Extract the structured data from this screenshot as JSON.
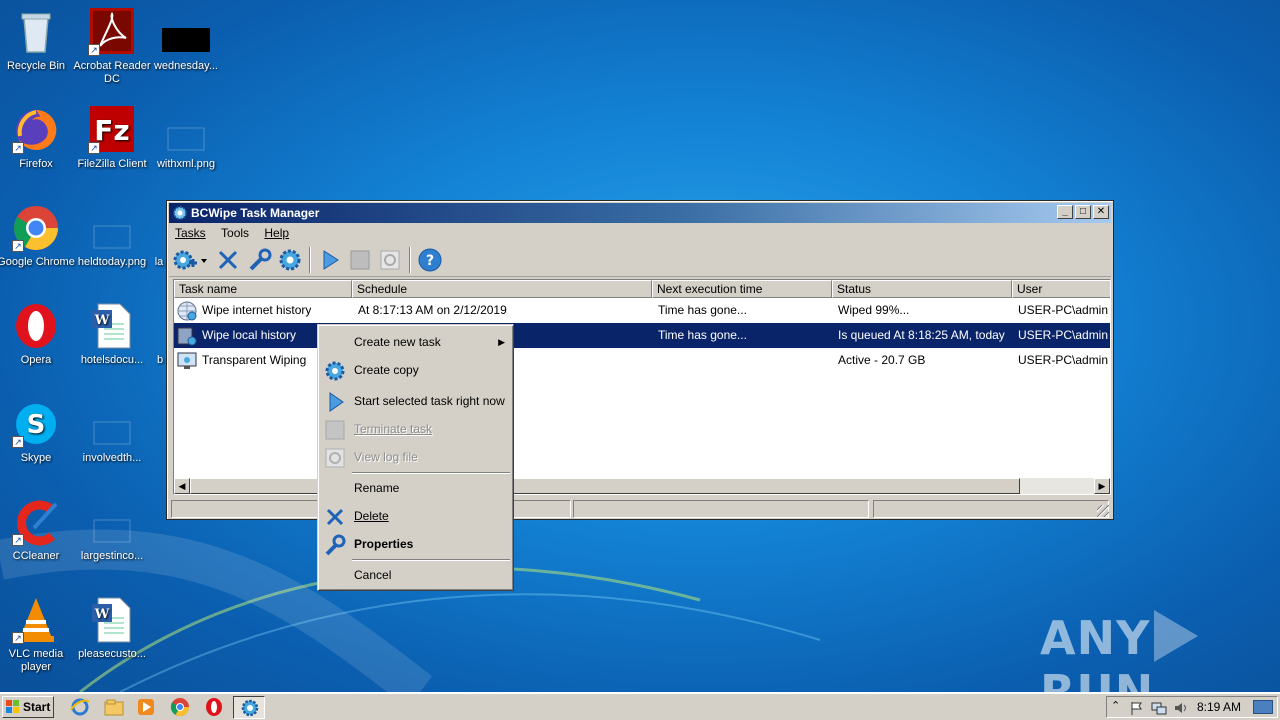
{
  "desktop": {
    "icons": [
      {
        "label": "Recycle Bin"
      },
      {
        "label": "Acrobat Reader DC"
      },
      {
        "label": "wednesday..."
      },
      {
        "label": "Firefox"
      },
      {
        "label": "FileZilla Client"
      },
      {
        "label": "withxml.png"
      },
      {
        "label": "Google Chrome"
      },
      {
        "label": "heldtoday.png"
      },
      {
        "label": "la"
      },
      {
        "label": "Opera"
      },
      {
        "label": "hotelsdocu..."
      },
      {
        "label": "b"
      },
      {
        "label": "Skype"
      },
      {
        "label": "involvedth..."
      },
      {
        "label": "CCleaner"
      },
      {
        "label": "largestinco..."
      },
      {
        "label": "VLC media player"
      },
      {
        "label": "pleasecusto..."
      }
    ]
  },
  "window": {
    "title": "BCWipe Task Manager",
    "controls": {
      "minimize": "_",
      "maximize": "□",
      "close": "✕"
    },
    "menu": [
      "Tasks",
      "Tools",
      "Help"
    ],
    "toolbar_icons": [
      "new-task-icon",
      "dropdown-arrow-icon",
      "delete-icon",
      "properties-wrench-icon",
      "copy-gear-icon",
      "start-icon",
      "stop-icon",
      "view-log-icon",
      "help-icon"
    ],
    "columns": [
      "Task name",
      "Schedule",
      "Next execution time",
      "Status",
      "User"
    ],
    "rows": [
      {
        "name": "Wipe internet history",
        "schedule": "At 8:17:13 AM on 2/12/2019",
        "next": "Time has gone...",
        "status": "Wiped 99%...",
        "user": "USER-PC\\admin",
        "selected": false
      },
      {
        "name": "Wipe local history",
        "schedule": "",
        "next": "Time has gone...",
        "status": "Is queued At 8:18:25 AM, today",
        "user": "USER-PC\\admin",
        "selected": true
      },
      {
        "name": "Transparent Wiping",
        "schedule": "",
        "next": "",
        "status": "Active - 20.7 GB",
        "user": "USER-PC\\admin",
        "selected": false
      }
    ]
  },
  "context_menu": {
    "items": [
      {
        "label": "Create new task",
        "icon": "none",
        "enabled": true,
        "submenu": "▶"
      },
      {
        "label": "Create copy",
        "icon": "gear-icon",
        "enabled": true
      },
      {
        "label": "Start selected task right now",
        "icon": "play-icon",
        "enabled": true
      },
      {
        "label": "Terminate task",
        "icon": "stop-icon",
        "enabled": false
      },
      {
        "label": "View log file",
        "icon": "log-icon",
        "enabled": false
      },
      {
        "label": "Rename",
        "icon": "none",
        "enabled": true
      },
      {
        "label": "Delete",
        "icon": "x-icon",
        "enabled": true
      },
      {
        "label": "Properties",
        "icon": "wrench-icon",
        "enabled": true,
        "bold": true
      },
      {
        "label": "Cancel",
        "icon": "none",
        "enabled": true
      }
    ]
  },
  "taskbar": {
    "start_label": "Start",
    "pinned": [
      "ie-icon",
      "explorer-icon",
      "media-player-icon",
      "chrome-icon",
      "opera-icon",
      "bcwipe-icon"
    ],
    "clock": "8:19 AM",
    "tray_icons": [
      "show-hidden-icon",
      "flag-icon",
      "network-icon",
      "volume-icon"
    ]
  },
  "watermark": {
    "left": "ANY",
    "right": "RUN"
  }
}
